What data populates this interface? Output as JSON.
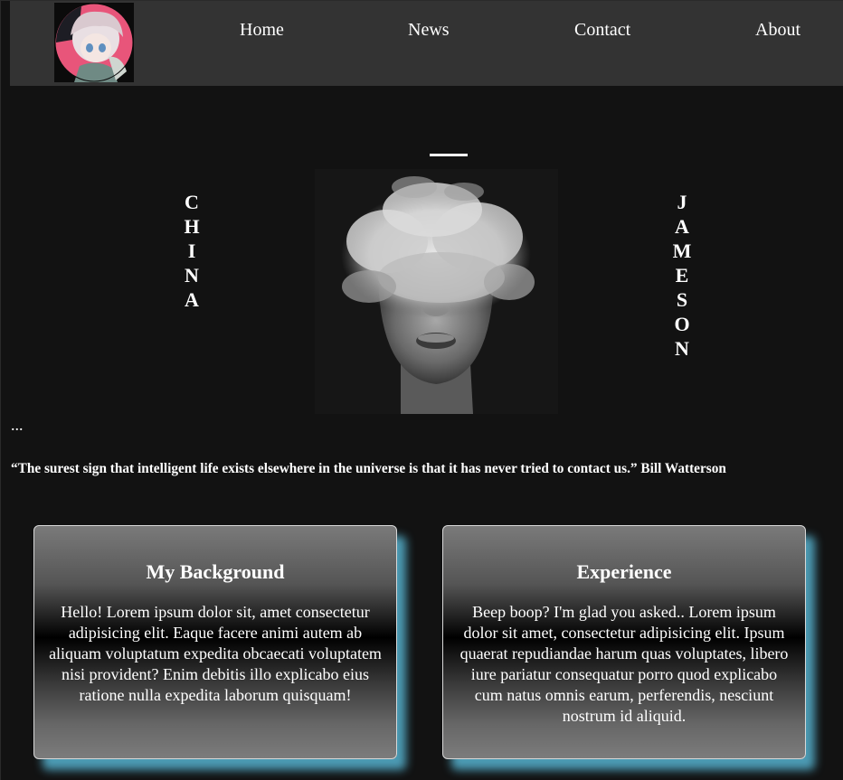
{
  "nav": {
    "links": [
      "Home",
      "News",
      "Contact",
      "About"
    ]
  },
  "hero": {
    "left_name_letters": [
      "C",
      "H",
      "I",
      "N",
      "A"
    ],
    "right_name_letters": [
      "J",
      "A",
      "M",
      "E",
      "S",
      "O",
      "N"
    ]
  },
  "ellipsis": "...",
  "quote": "“The surest sign that intelligent life exists elsewhere in the universe is that it has never tried to contact us.” Bill Watterson",
  "cards": [
    {
      "title": "My Background",
      "body": "Hello! Lorem ipsum dolor sit, amet consectetur adipisicing elit. Eaque facere animi autem ab aliquam voluptatum expedita obcaecati voluptatem nisi provident? Enim debitis illo explicabo eius ratione nulla expedita laborum quisquam!"
    },
    {
      "title": "Experience",
      "body": "Beep boop? I'm glad you asked.. Lorem ipsum dolor sit amet, consectetur adipisicing elit. Ipsum quaerat repudiandae harum quas voluptates, libero iure pariatur consequatur porro quod explicabo cum natus omnis earum, perferendis, nesciunt nostrum id aliquid."
    }
  ],
  "colors": {
    "background": "#121212",
    "nav_background": "#333333",
    "card_glow": "#60c9eb",
    "text": "#ffffff"
  },
  "icons": {
    "logo": "avatar-logo-icon",
    "portrait": "smoke-face-image"
  }
}
